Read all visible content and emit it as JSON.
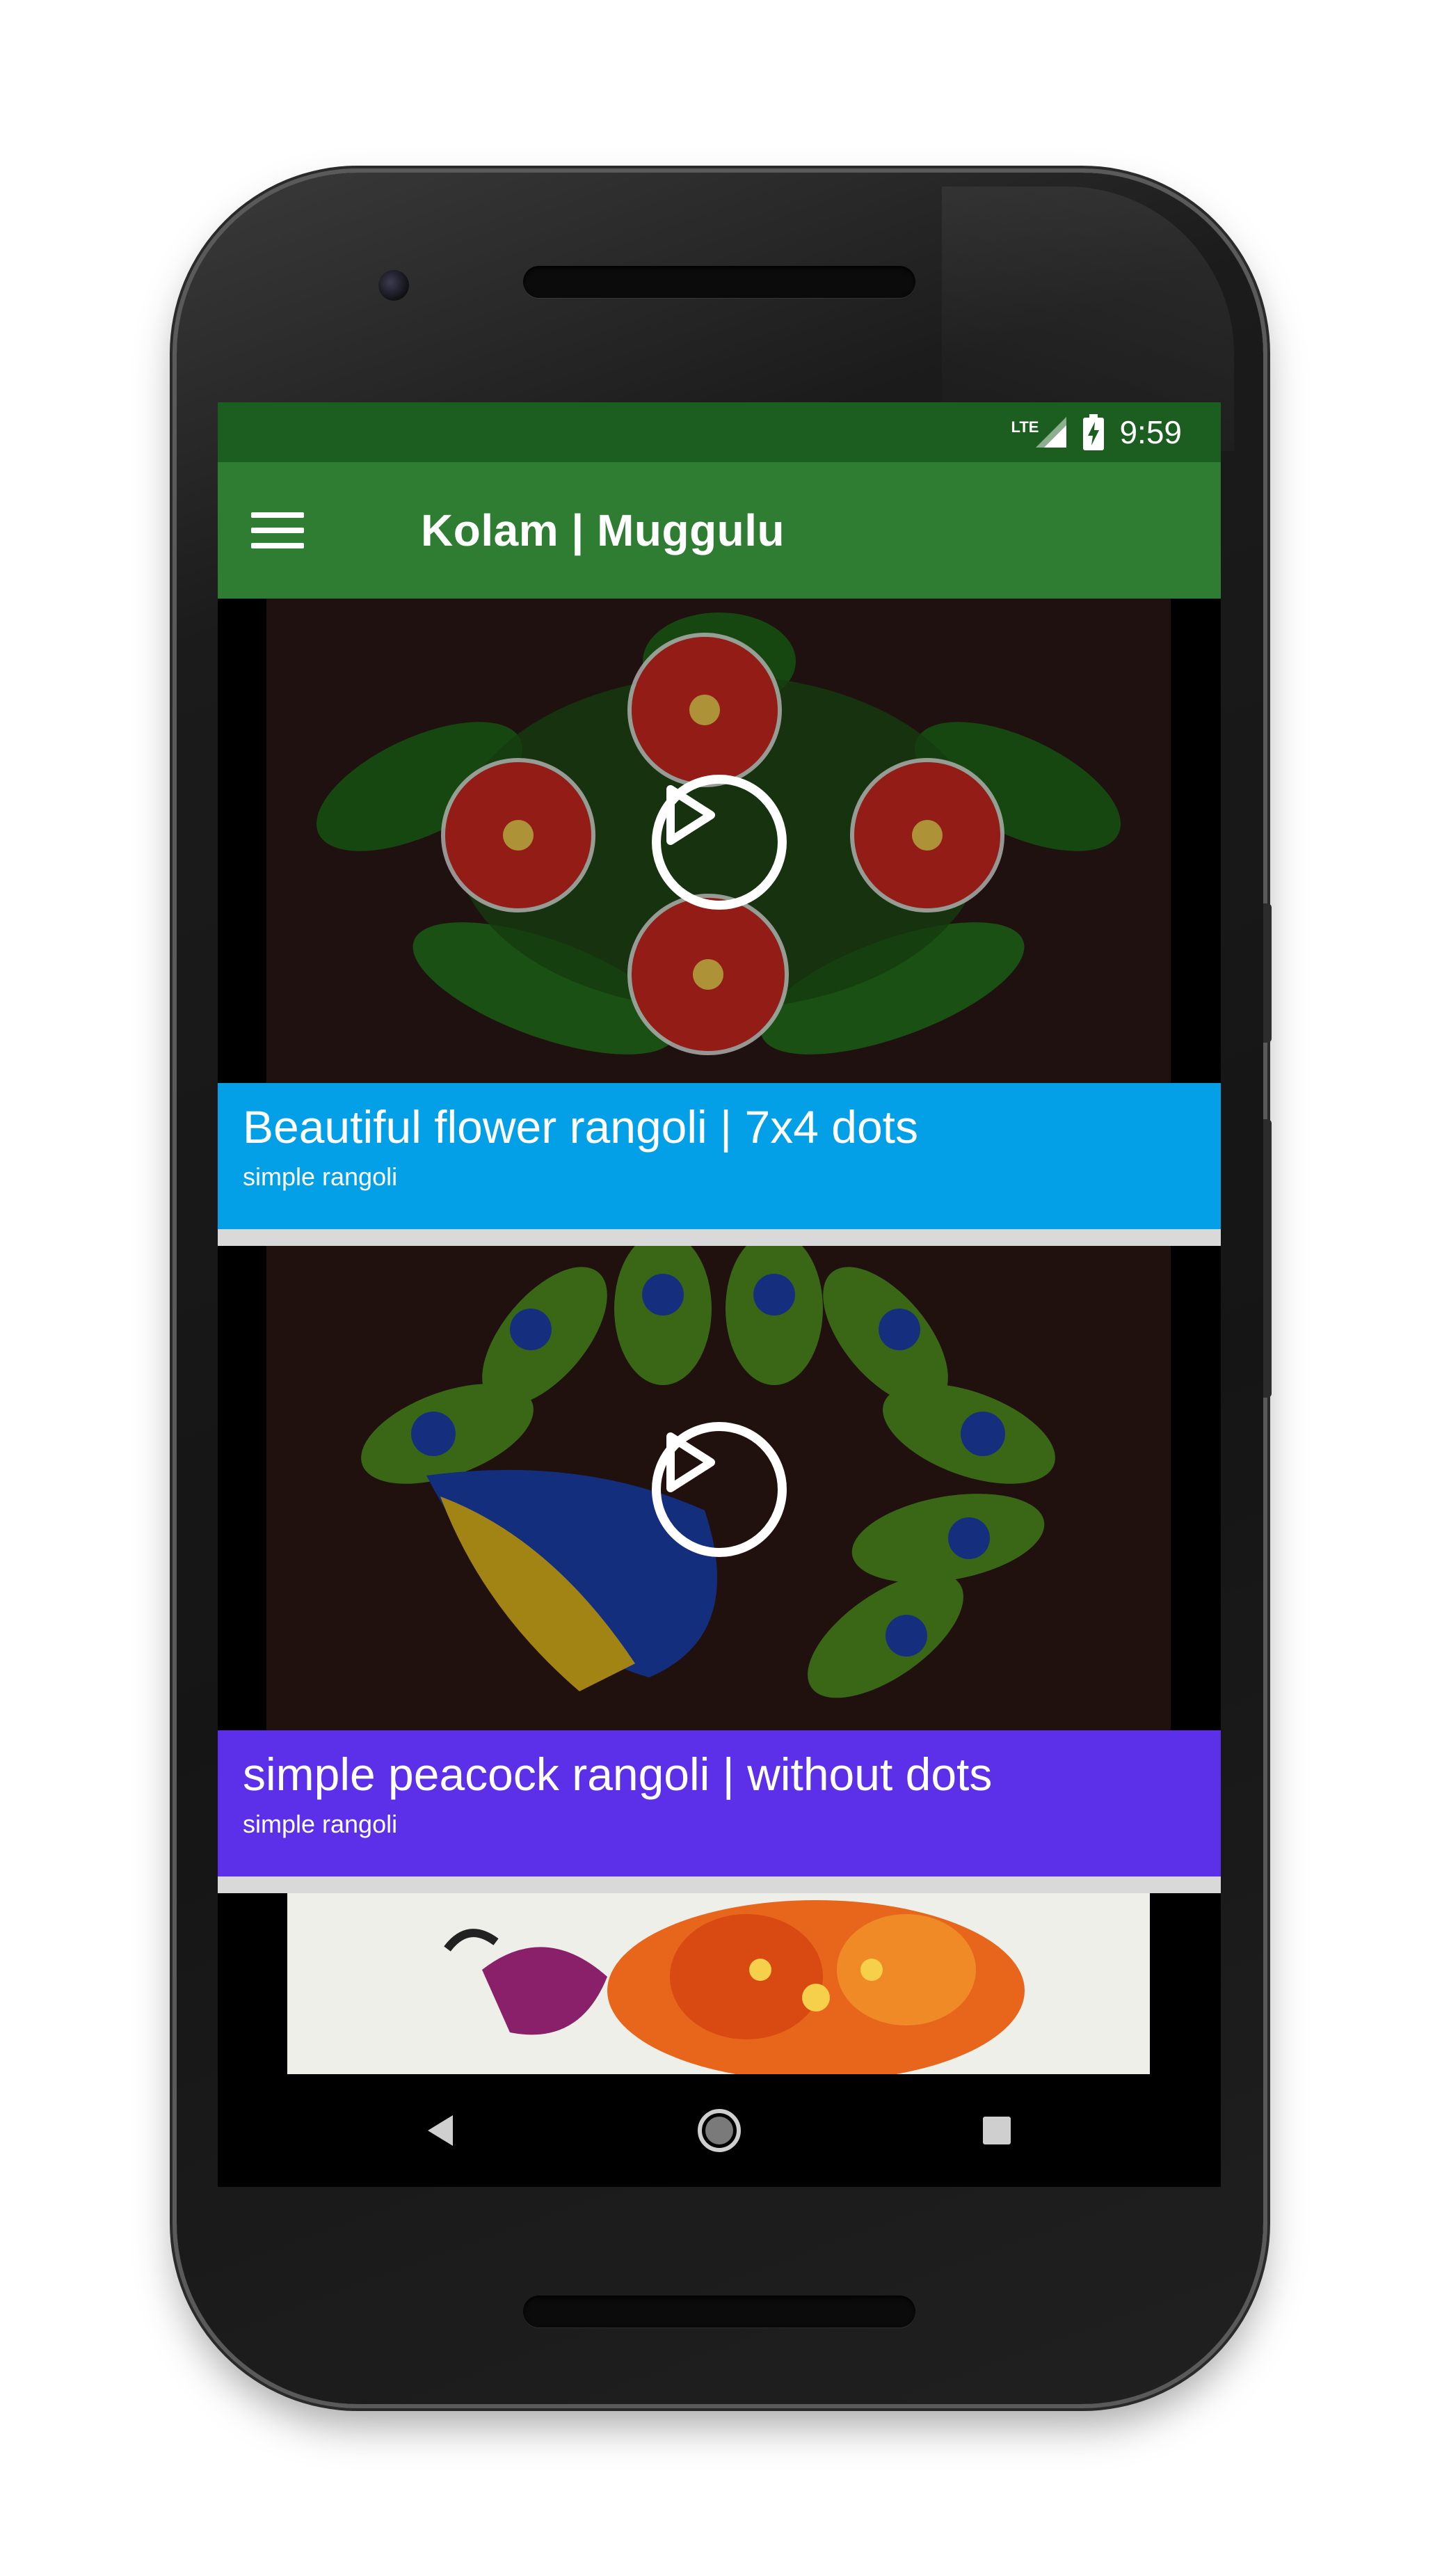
{
  "status_bar": {
    "network_label": "LTE",
    "time": "9:59"
  },
  "app_bar": {
    "title": "Kolam | Muggulu"
  },
  "videos": [
    {
      "title": "Beautiful flower rangoli | 7x4 dots",
      "subtitle": "simple rangoli",
      "caption_color": "#03a0e8",
      "thumbnail": "red-hibiscus-rangoli"
    },
    {
      "title": "simple peacock rangoli | without dots",
      "subtitle": "simple rangoli",
      "caption_color": "#5b30e8",
      "thumbnail": "peacock-rangoli"
    },
    {
      "thumbnail": "orange-peacock-rangoli-partial"
    }
  ],
  "colors": {
    "status_bar": "#1b5e20",
    "app_bar": "#2e7d32",
    "divider": "#d9d9d9"
  }
}
